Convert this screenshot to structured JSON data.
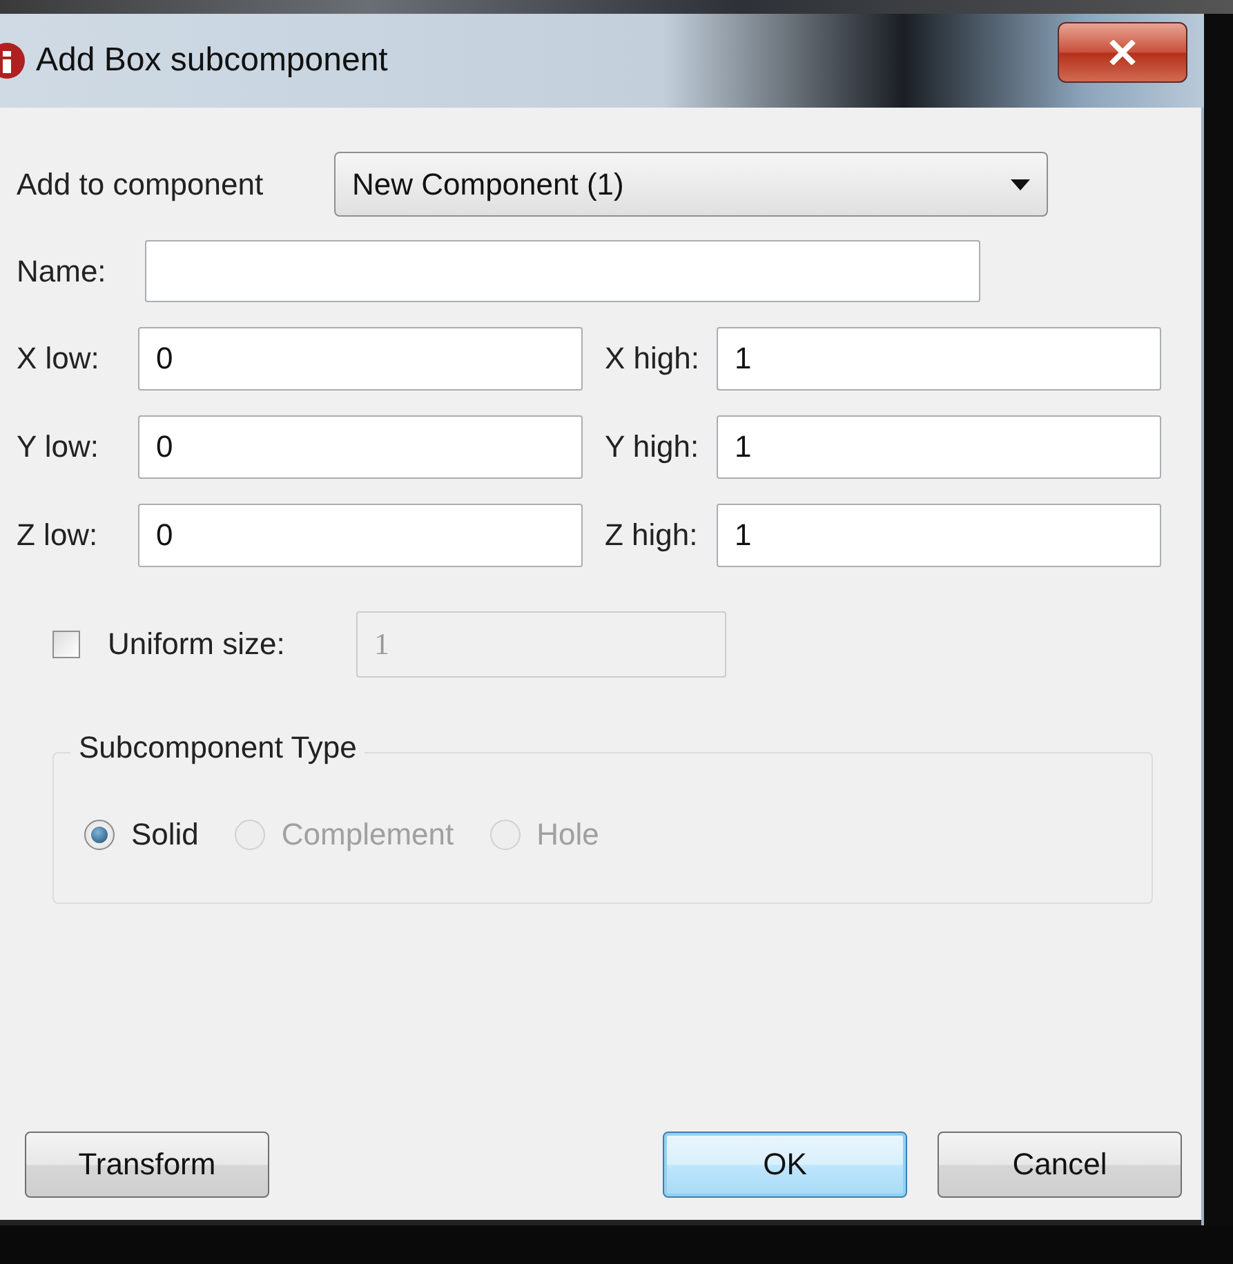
{
  "window": {
    "title": "Add Box subcomponent"
  },
  "component": {
    "label": "Add to component",
    "value": "New Component (1)"
  },
  "name": {
    "label": "Name:"
  },
  "bounds": [
    {
      "low_label": "X low:",
      "low_value": "0",
      "high_label": "X high:",
      "high_value": "1"
    },
    {
      "low_label": "Y low:",
      "low_value": "0",
      "high_label": "Y high:",
      "high_value": "1"
    },
    {
      "low_label": "Z low:",
      "low_value": "0",
      "high_label": "Z high:",
      "high_value": "1"
    }
  ],
  "uniform_size": {
    "label": "Uniform size:",
    "checked": false,
    "value": "1",
    "disabled": true
  },
  "subcomponent_type": {
    "title": "Subcomponent Type",
    "options": [
      {
        "label": "Solid",
        "selected": true,
        "disabled": false
      },
      {
        "label": "Complement",
        "selected": false,
        "disabled": true
      },
      {
        "label": "Hole",
        "selected": false,
        "disabled": true
      }
    ]
  },
  "buttons": [
    {
      "label": "Transform",
      "default": false
    },
    {
      "label": "OK",
      "default": true
    },
    {
      "label": "Cancel",
      "default": false
    }
  ]
}
